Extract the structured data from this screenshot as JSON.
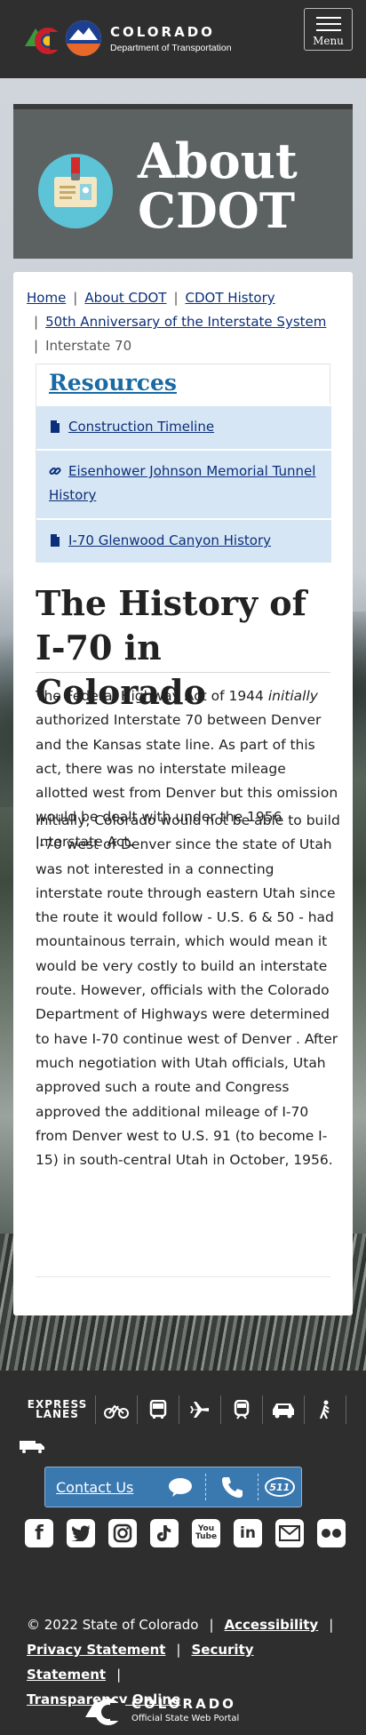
{
  "header": {
    "logo_title": "COLORADO",
    "logo_subtitle": "Department of Transportation",
    "menu_label": "Menu"
  },
  "hero": {
    "title_line1": "About",
    "title_line2": "CDOT"
  },
  "breadcrumb": {
    "items": [
      "Home",
      "About CDOT",
      "CDOT History",
      "50th Anniversary of the Interstate System"
    ],
    "current": "Interstate 70"
  },
  "resources": {
    "heading": "Resources",
    "items": [
      {
        "label": "Construction Timeline",
        "icon": "document-icon"
      },
      {
        "label": "Eisenhower Johnson Memorial Tunnel History",
        "icon": "link-icon"
      },
      {
        "label": "I-70 Glenwood Canyon History",
        "icon": "document-icon"
      }
    ]
  },
  "article": {
    "title": "The History of I-70 in Colorado",
    "p1_a": "The Federal Highway Act of 1944 ",
    "p1_em": "initially",
    "p1_b": " authorized Interstate 70 between Denver and the Kansas state line. As part of this act, there was no interstate mileage allotted west from Denver but this omission would be dealt with under the 1956 Interstate Act.",
    "p2": "Initially, Colorado would not be able to build I-70 west of Denver since the state of Utah was not interested in a connecting interstate route through eastern Utah since the route it would follow - U.S. 6 & 50 - had mountainous terrain, which would mean it would be very costly to build an interstate route. However, officials with the Colorado Department of Highways were determined to have I-70 continue west of Denver . After much negotiation with Utah officials, Utah approved such a route and Congress approved the additional mileage of I-70 from Denver west to U.S. 91 (to become I-15) in south-central Utah in October, 1956."
  },
  "footer": {
    "express_lanes_line1": "EXPRESS",
    "express_lanes_line2": "LANES",
    "contact_label": "Contact Us",
    "contact_511": "511",
    "social": [
      "f",
      "twitter",
      "instagram",
      "tiktok",
      "YouTube",
      "in",
      "email",
      "flickr"
    ],
    "copyright": "© 2022 State of Colorado",
    "links": [
      "Accessibility",
      "Privacy Statement",
      "Security Statement",
      "Transparency Online"
    ],
    "state_title": "COLORADO",
    "state_subtitle": "Official State Web Portal",
    "youtube_text": "You Tube"
  },
  "colors": {
    "header_bg": "#2f2f2f",
    "hero_bg": "#5c6262",
    "link": "#0b2f7a",
    "resources_heading": "#1a6aa3",
    "resource_item_bg": "#d6e6f4",
    "contact_bg": "#3a78b0"
  }
}
